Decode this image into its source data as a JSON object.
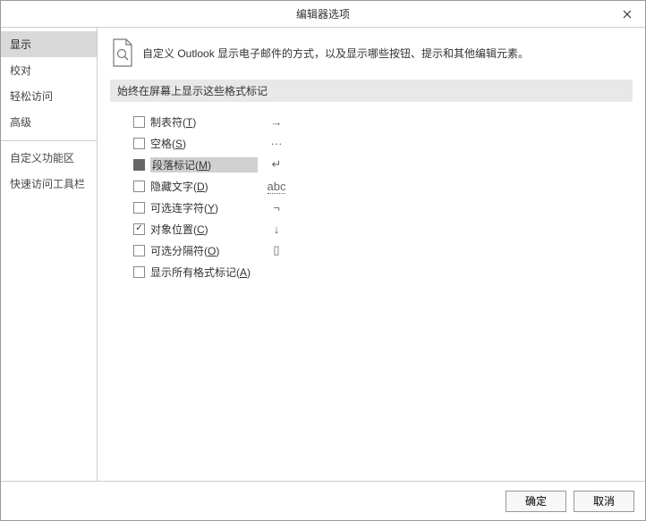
{
  "window": {
    "title": "编辑器选项"
  },
  "sidebar": {
    "items": [
      {
        "label": "显示",
        "selected": true
      },
      {
        "label": "校对",
        "selected": false
      },
      {
        "label": "轻松访问",
        "selected": false
      },
      {
        "label": "高级",
        "selected": false
      }
    ],
    "items2": [
      {
        "label": "自定义功能区",
        "selected": false
      },
      {
        "label": "快速访问工具栏",
        "selected": false
      }
    ]
  },
  "main": {
    "header": "自定义 Outlook 显示电子邮件的方式，以及显示哪些按钮、提示和其他编辑元素。",
    "section_title": "始终在屏幕上显示这些格式标记",
    "options": [
      {
        "label": "制表符",
        "accel": "T",
        "symbol": "→",
        "checked": false,
        "indet": false,
        "hl": false
      },
      {
        "label": "空格",
        "accel": "S",
        "symbol": "···",
        "checked": false,
        "indet": false,
        "hl": false
      },
      {
        "label": "段落标记",
        "accel": "M",
        "symbol": "↵",
        "checked": false,
        "indet": true,
        "hl": true
      },
      {
        "label": "隐藏文字",
        "accel": "D",
        "symbol": "abc",
        "checked": false,
        "indet": false,
        "hl": false
      },
      {
        "label": "可选连字符",
        "accel": "Y",
        "symbol": "¬",
        "checked": false,
        "indet": false,
        "hl": false
      },
      {
        "label": "对象位置",
        "accel": "C",
        "symbol": "↓",
        "checked": true,
        "indet": false,
        "hl": false
      },
      {
        "label": "可选分隔符",
        "accel": "O",
        "symbol": "▯",
        "checked": false,
        "indet": false,
        "hl": false
      },
      {
        "label": "显示所有格式标记",
        "accel": "A",
        "symbol": "",
        "checked": false,
        "indet": false,
        "hl": false
      }
    ]
  },
  "footer": {
    "ok": "确定",
    "cancel": "取消"
  }
}
